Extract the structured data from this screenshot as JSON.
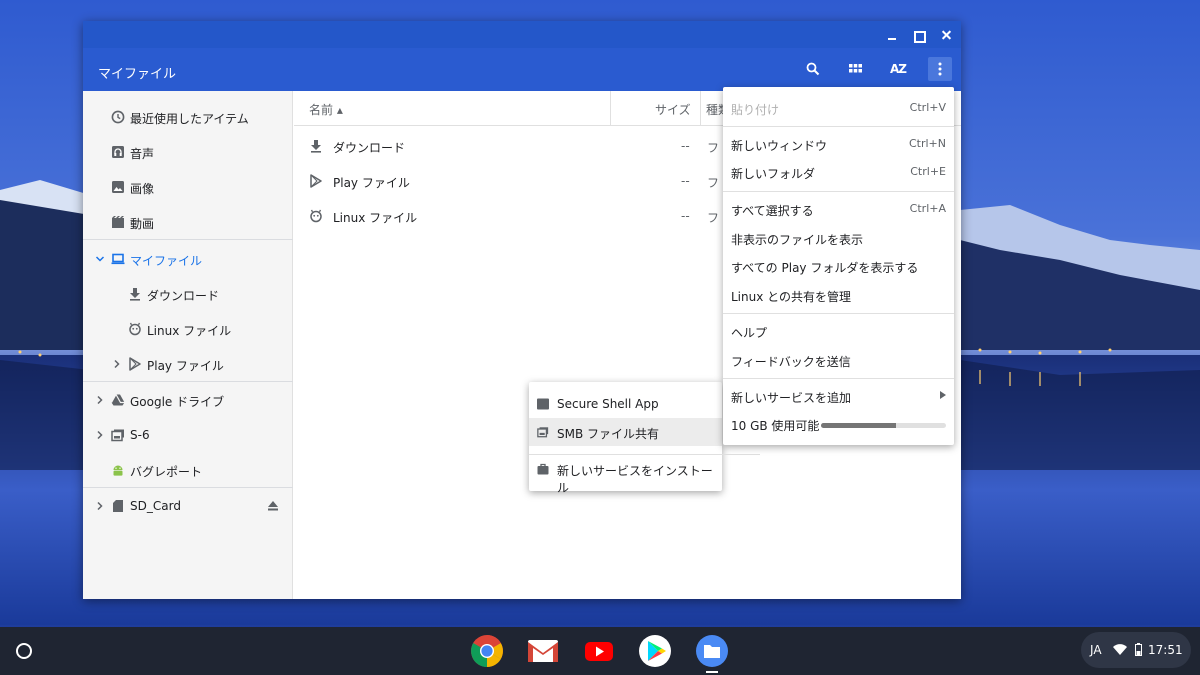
{
  "window": {
    "title": "マイファイル"
  },
  "sidebar": {
    "items": [
      {
        "label": "最近使用したアイテム",
        "icon": "clock-icon"
      },
      {
        "label": "音声",
        "icon": "audio-icon"
      },
      {
        "label": "画像",
        "icon": "image-icon"
      },
      {
        "label": "動画",
        "icon": "video-icon"
      },
      {
        "label": "マイファイル",
        "icon": "laptop-icon",
        "expanded": true,
        "selected": true
      },
      {
        "label": "ダウンロード",
        "icon": "download-icon"
      },
      {
        "label": "Linux ファイル",
        "icon": "linux-icon"
      },
      {
        "label": "Play ファイル",
        "icon": "play-icon"
      },
      {
        "label": "Google ドライブ",
        "icon": "drive-icon"
      },
      {
        "label": "S-6",
        "icon": "smb-icon"
      },
      {
        "label": "バグレポート",
        "icon": "android-icon"
      },
      {
        "label": "SD_Card",
        "icon": "sd-card-icon"
      }
    ]
  },
  "filelist": {
    "columns": {
      "name": "名前 ▴",
      "size": "サイズ",
      "type": "種類"
    },
    "rows": [
      {
        "name": "ダウンロード",
        "size": "--",
        "type": "フ",
        "icon": "download-icon"
      },
      {
        "name": "Play ファイル",
        "size": "--",
        "type": "フ",
        "icon": "play-icon"
      },
      {
        "name": "Linux ファイル",
        "size": "--",
        "type": "フ",
        "icon": "linux-icon"
      }
    ]
  },
  "menu": {
    "items": [
      {
        "label": "貼り付け",
        "shortcut": "Ctrl+V",
        "disabled": true
      },
      {
        "label": "新しいウィンドウ",
        "shortcut": "Ctrl+N"
      },
      {
        "label": "新しいフォルダ",
        "shortcut": "Ctrl+E"
      },
      {
        "label": "すべて選択する",
        "shortcut": "Ctrl+A"
      },
      {
        "label": "非表示のファイルを表示",
        "shortcut": ""
      },
      {
        "label": "すべての Play フォルダを表示する",
        "shortcut": ""
      },
      {
        "label": "Linux との共有を管理",
        "shortcut": ""
      },
      {
        "label": "ヘルプ",
        "shortcut": ""
      },
      {
        "label": "フィードバックを送信",
        "shortcut": ""
      },
      {
        "label": "新しいサービスを追加",
        "shortcut": "",
        "submenu": true
      }
    ],
    "storage": {
      "label": "10 GB 使用可能",
      "used_fraction": 0.6
    }
  },
  "submenu": {
    "items": [
      {
        "label": "Secure Shell App",
        "icon": "terminal-icon"
      },
      {
        "label": "SMB ファイル共有",
        "icon": "smb-icon",
        "highlighted": true
      },
      {
        "label": "新しいサービスをインストール",
        "icon": "bag-icon"
      }
    ]
  },
  "shelf": {
    "apps": [
      "chrome",
      "gmail",
      "youtube",
      "play-store",
      "files"
    ],
    "tray": {
      "ime": "JA",
      "time": "17:51"
    }
  }
}
